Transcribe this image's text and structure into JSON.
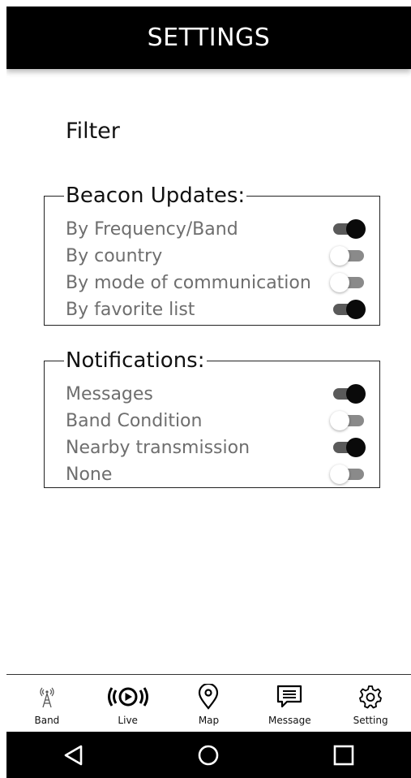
{
  "header": {
    "title": "SETTINGS"
  },
  "page": {
    "section_title": "Filter"
  },
  "beacon": {
    "legend": "Beacon Updates:",
    "items": [
      {
        "label": "By Frequency/Band",
        "on": true
      },
      {
        "label": "By country",
        "on": false
      },
      {
        "label": "By mode of communication",
        "on": false
      },
      {
        "label": "By favorite list",
        "on": true
      }
    ]
  },
  "notifications": {
    "legend": "Notifications:",
    "items": [
      {
        "label": "Messages",
        "on": true
      },
      {
        "label": "Band Condition",
        "on": false
      },
      {
        "label": "Nearby transmission",
        "on": true
      },
      {
        "label": "None",
        "on": false
      }
    ]
  },
  "tabs": [
    {
      "label": "Band",
      "icon": "antenna-icon"
    },
    {
      "label": "Live",
      "icon": "live-icon"
    },
    {
      "label": "Map",
      "icon": "map-pin-icon"
    },
    {
      "label": "Message",
      "icon": "message-icon"
    },
    {
      "label": "Setting",
      "icon": "gear-icon"
    }
  ],
  "colors": {
    "header_bg": "#000000",
    "toggle_on_knob": "#0a0a0a",
    "toggle_off_knob": "#ffffff",
    "label_gray": "#6e6e6e"
  }
}
